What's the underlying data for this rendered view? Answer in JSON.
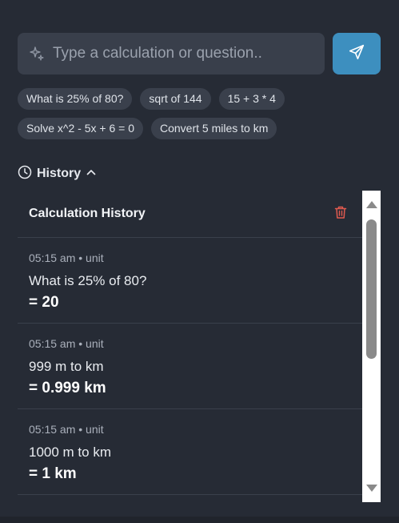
{
  "search": {
    "placeholder": "Type a calculation or question..",
    "value": ""
  },
  "icons": {
    "search": "sparkle-icon",
    "send": "send-icon",
    "history": "clock-icon",
    "collapse": "chevron-up-icon",
    "clear": "trash-icon"
  },
  "colors": {
    "send_button": "#3d8fbf",
    "trash": "#e05a4f"
  },
  "suggestions": [
    "What is 25% of 80?",
    "sqrt of 144",
    "15 + 3 * 4",
    "Solve x^2 - 5x + 6 = 0",
    "Convert 5 miles to km"
  ],
  "history": {
    "toggle_label": "History",
    "title": "Calculation History",
    "entries": [
      {
        "meta": "05:15 am • unit",
        "query": "What is 25% of 80?",
        "result": "= 20"
      },
      {
        "meta": "05:15 am • unit",
        "query": "999 m to km",
        "result": "= 0.999 km"
      },
      {
        "meta": "05:15 am • unit",
        "query": "1000 m to km",
        "result": "= 1 km"
      }
    ]
  }
}
